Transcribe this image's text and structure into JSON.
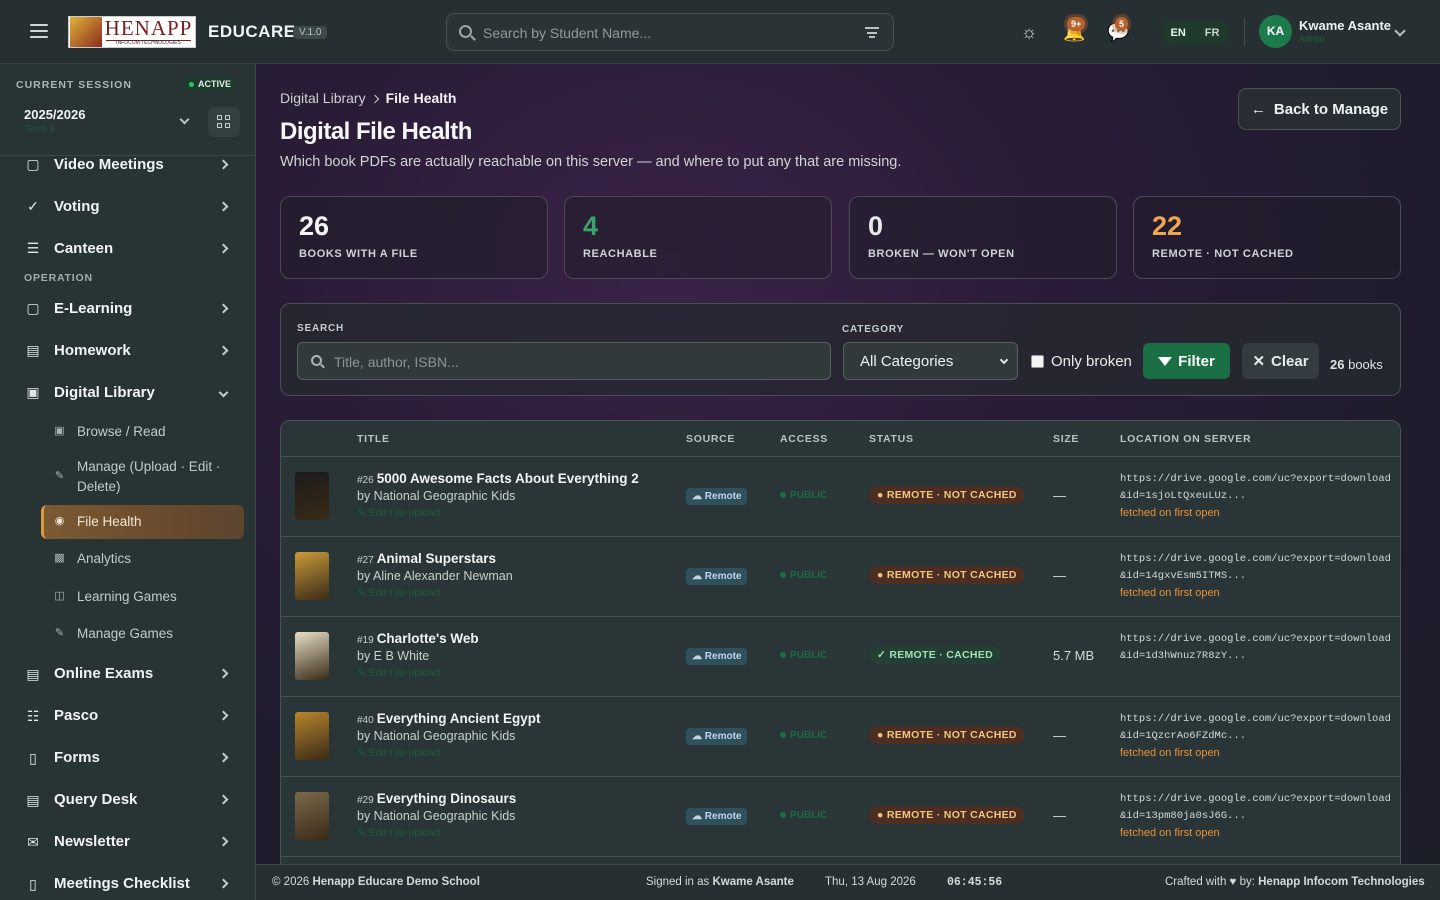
{
  "app": {
    "brand": "EDUCARE",
    "version": "V.1.0",
    "logo_title": "HENAPP",
    "logo_subtitle": "INFOCOM TECHNOLOGIES"
  },
  "topbar": {
    "search_placeholder": "Search by Student Name...",
    "notifications_badge": "9+",
    "messages_badge": "5",
    "lang_en": "EN",
    "lang_fr": "FR",
    "avatar_initials": "KA",
    "user_name": "Kwame Asante",
    "user_role": "Admin"
  },
  "sidebar": {
    "session_label": "CURRENT SESSION",
    "session_status": "ACTIVE",
    "session_year": "2025/2026",
    "session_term": "Term 3",
    "items_top": [
      {
        "label": "Video Meetings",
        "icon": "video-icon"
      },
      {
        "label": "Voting",
        "icon": "check-circle-icon"
      },
      {
        "label": "Canteen",
        "icon": "cart-icon"
      }
    ],
    "section_operation": "OPERATION",
    "items_ops": [
      {
        "label": "E-Learning",
        "icon": "video-icon"
      },
      {
        "label": "Homework",
        "icon": "document-icon"
      },
      {
        "label": "Digital Library",
        "icon": "monitor-icon"
      }
    ],
    "library_sub": [
      {
        "label": "Browse / Read",
        "icon": "monitor-icon"
      },
      {
        "label": "Manage (Upload · Edit · Delete)",
        "icon": "edit-icon"
      },
      {
        "label": "File Health",
        "icon": "check-circle-icon"
      },
      {
        "label": "Analytics",
        "icon": "chart-icon"
      },
      {
        "label": "Learning Games",
        "icon": "gamepad-icon"
      },
      {
        "label": "Manage Games",
        "icon": "edit-icon"
      }
    ],
    "items_bottom": [
      {
        "label": "Online Exams",
        "icon": "document-icon"
      },
      {
        "label": "Pasco",
        "icon": "book-icon"
      },
      {
        "label": "Forms",
        "icon": "clipboard-icon"
      },
      {
        "label": "Query Desk",
        "icon": "document-icon"
      },
      {
        "label": "Newsletter",
        "icon": "mail-icon"
      },
      {
        "label": "Meetings Checklist",
        "icon": "clipboard-icon"
      }
    ]
  },
  "page": {
    "breadcrumb_parent": "Digital Library",
    "breadcrumb_current": "File Health",
    "title": "Digital File Health",
    "subtitle": "Which book PDFs are actually reachable on this server — and where to put any that are missing.",
    "back_button": "Back to Manage"
  },
  "stats": [
    {
      "value": "26",
      "label": "BOOKS WITH A FILE",
      "color": "#f4f6f5"
    },
    {
      "value": "4",
      "label": "REACHABLE",
      "color": "#3aa56a"
    },
    {
      "value": "0",
      "label": "BROKEN — WON'T OPEN",
      "color": "#e6e8ea"
    },
    {
      "value": "22",
      "label": "REMOTE · NOT CACHED",
      "color": "#f0a64a"
    }
  ],
  "filters": {
    "search_label": "SEARCH",
    "search_placeholder": "Title, author, ISBN...",
    "category_label": "CATEGORY",
    "category_value": "All Categories",
    "only_broken": "Only broken",
    "filter_button": "Filter",
    "clear_button": "Clear",
    "count_value": "26",
    "count_unit": "books"
  },
  "table": {
    "headers": {
      "title": "TITLE",
      "source": "SOURCE",
      "access": "ACCESS",
      "status": "STATUS",
      "size": "SIZE",
      "location": "LOCATION ON SERVER"
    },
    "rows": [
      {
        "num": "#26",
        "title": "5000 Awesome Facts About Everything 2",
        "author": "by National Geographic Kids",
        "edit": "✎ Edit / re-upload",
        "source": "Remote",
        "access": "PUBLIC",
        "status": "REMOTE · NOT CACHED",
        "size": "—",
        "loc1": "https://drive.google.com/uc?export=download",
        "loc2": "&id=1sjoLtQxeuLUz...",
        "note": "fetched on first open",
        "cover": "#1b1b1b"
      },
      {
        "num": "#27",
        "title": "Animal Superstars",
        "author": "by Aline Alexander Newman",
        "edit": "✎ Edit / re-upload",
        "source": "Remote",
        "access": "PUBLIC",
        "status": "REMOTE · NOT CACHED",
        "size": "—",
        "loc1": "https://drive.google.com/uc?export=download",
        "loc2": "&id=14gxvEsm5ITMS...",
        "note": "fetched on first open",
        "cover": "#c99a3a"
      },
      {
        "num": "#19",
        "title": "Charlotte's Web",
        "author": "by E B White",
        "edit": "✎ Edit / re-upload",
        "source": "Remote",
        "access": "PUBLIC",
        "status": "REMOTE · CACHED",
        "size": "5.7 MB",
        "loc1": "https://drive.google.com/uc?export=download",
        "loc2": "&id=1d3hWnuz7R8zY...",
        "note": "",
        "cover": "#e8dfc6"
      },
      {
        "num": "#40",
        "title": "Everything Ancient Egypt",
        "author": "by National Geographic Kids",
        "edit": "✎ Edit / re-upload",
        "source": "Remote",
        "access": "PUBLIC",
        "status": "REMOTE · NOT CACHED",
        "size": "—",
        "loc1": "https://drive.google.com/uc?export=download",
        "loc2": "&id=1QzcrAo6FZdMc...",
        "note": "fetched on first open",
        "cover": "#b8862b"
      },
      {
        "num": "#29",
        "title": "Everything Dinosaurs",
        "author": "by National Geographic Kids",
        "edit": "✎ Edit / re-upload",
        "source": "Remote",
        "access": "PUBLIC",
        "status": "REMOTE · NOT CACHED",
        "size": "—",
        "loc1": "https://drive.google.com/uc?export=download",
        "loc2": "&id=13pm80ja0sJ6G...",
        "note": "fetched on first open",
        "cover": "#7a6a4a"
      }
    ]
  },
  "footer": {
    "copyright": "© 2026",
    "school": "Henapp Educare Demo School",
    "signed_prefix": "Signed in as",
    "signed_user": "Kwame Asante",
    "date": "Thu, 13 Aug 2026",
    "time": "06:45:56",
    "crafted": "Crafted with ♥ by:",
    "company": "Henapp Infocom Technologies"
  }
}
